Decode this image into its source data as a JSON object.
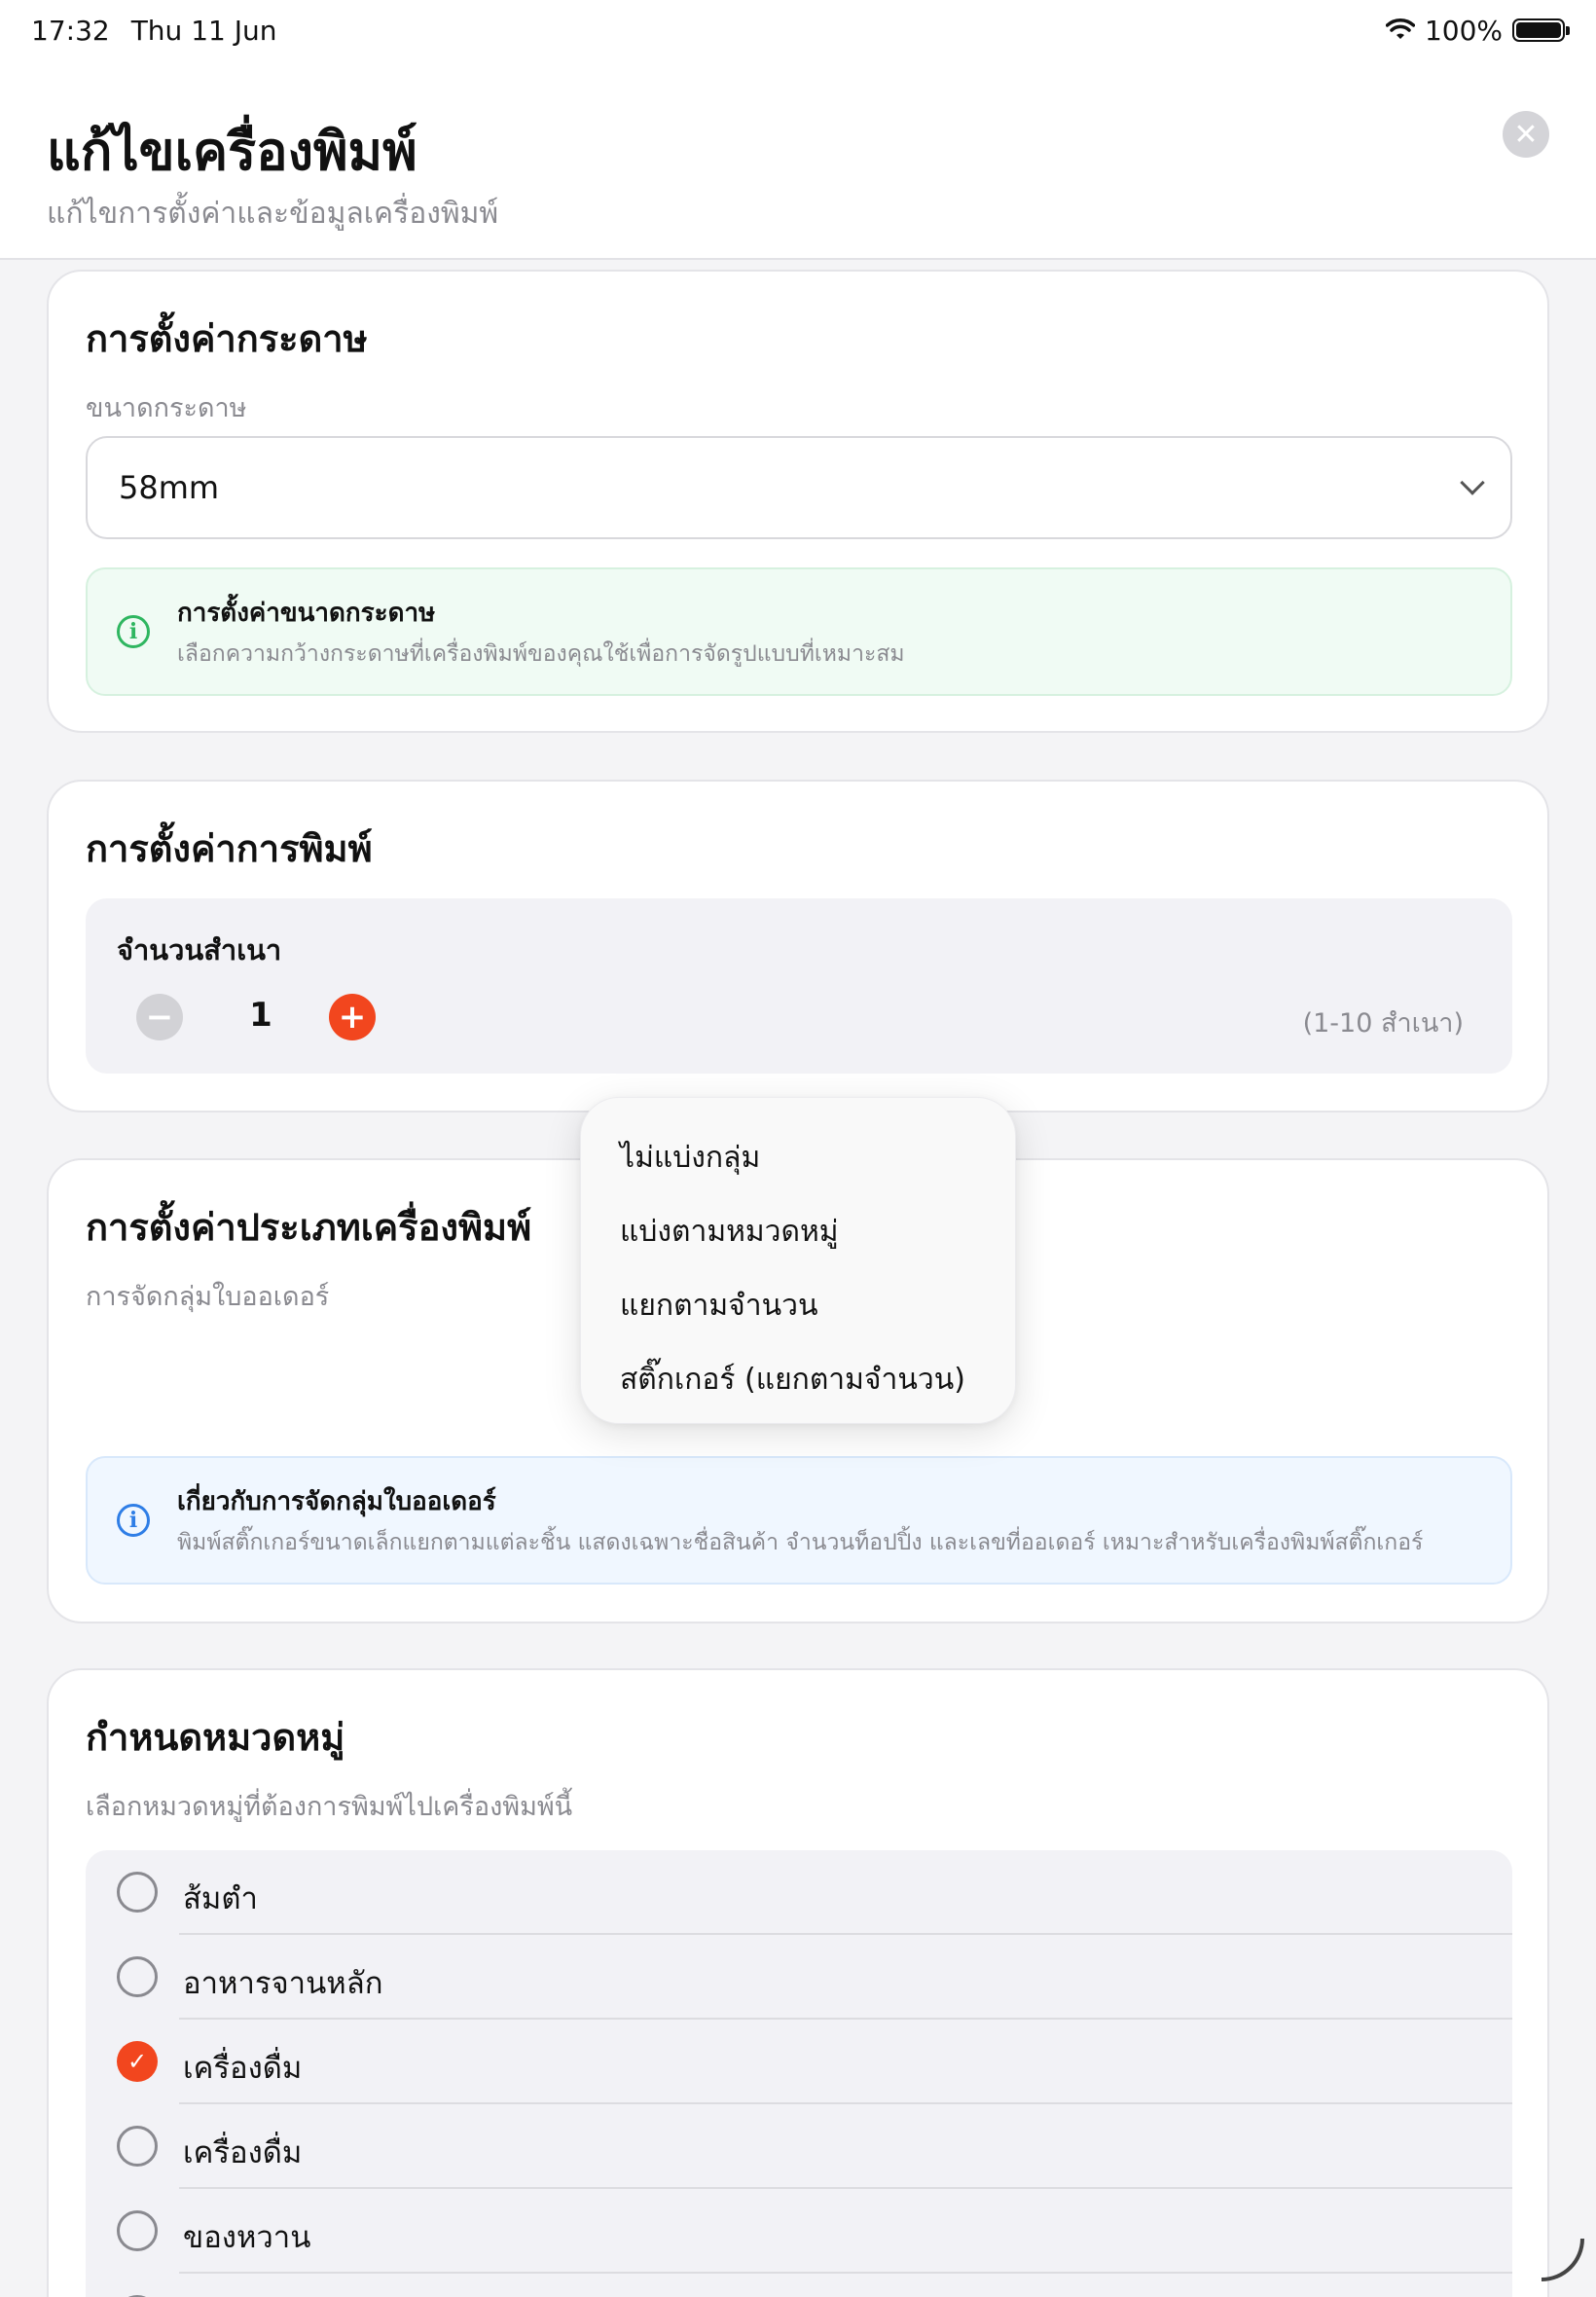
{
  "status_bar": {
    "time": "17:32",
    "date": "Thu 11 Jun",
    "battery": "100%",
    "icons": [
      "wifi-icon",
      "battery-icon"
    ]
  },
  "header": {
    "title": "แก้ไขเครื่องพิมพ์",
    "subtitle": "แก้ไขการตั้งค่าและข้อมูลเครื่องพิมพ์",
    "close_icon": "close-icon"
  },
  "paper": {
    "title": "การตั้งค่ากระดาษ",
    "size_label": "ขนาดกระดาษ",
    "size_value": "58mm",
    "info_title": "การตั้งค่าขนาดกระดาษ",
    "info_desc": "เลือกความกว้างกระดาษที่เครื่องพิมพ์ของคุณใช้เพื่อการจัดรูปแบบที่เหมาะสม"
  },
  "print": {
    "title": "การตั้งค่าการพิมพ์",
    "copies_label": "จำนวนสำเนา",
    "copies_value": "1",
    "copies_range": "(1-10 สำเนา)"
  },
  "printer_type": {
    "title": "การตั้งค่าประเภทเครื่องพิมพ์",
    "grouping_label": "การจัดกลุ่มใบออเดอร์",
    "info_title": "เกี่ยวกับการจัดกลุ่มใบออเดอร์",
    "info_desc": "พิมพ์สติ๊กเกอร์ขนาดเล็กแยกตามแต่ละชิ้น แสดงเฉพาะชื่อสินค้า จำนวนท็อปปิ้ง และเลขที่ออเดอร์ เหมาะสำหรับเครื่องพิมพ์สติ๊กเกอร์"
  },
  "grouping_menu": {
    "options": [
      "ไม่แบ่งกลุ่ม",
      "แบ่งตามหมวดหมู่",
      "แยกตามจำนวน",
      "สติ๊กเกอร์ (แยกตามจำนวน)"
    ]
  },
  "categories": {
    "title": "กำหนดหมวดหมู่",
    "subtitle": "เลือกหมวดหมู่ที่ต้องการพิมพ์ไปเครื่องพิมพ์นี้",
    "items": [
      {
        "label": "ส้มตำ",
        "checked": false
      },
      {
        "label": "อาหารจานหลัก",
        "checked": false
      },
      {
        "label": "เครื่องดื่ม",
        "checked": true
      },
      {
        "label": "เครื่องดื่ม",
        "checked": false
      },
      {
        "label": "ของหวาน",
        "checked": false
      }
    ]
  },
  "colors": {
    "accent": "#f2461e",
    "info_green": "#2fb660",
    "info_blue": "#2f7ee6"
  }
}
